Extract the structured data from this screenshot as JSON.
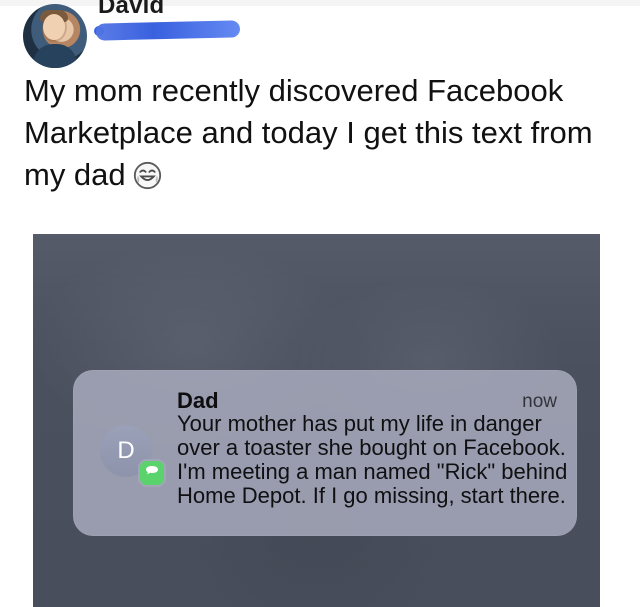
{
  "post": {
    "author_name": "David",
    "text": "My mom recently discovered Facebook Marketplace and today I get this text from my dad"
  },
  "icons": {
    "author_avatar": "profile-photo",
    "emoji": "face-with-tears-of-joy-icon",
    "contact_avatar": "contact-initial-avatar",
    "message_badge": "messages-app-icon"
  },
  "notification": {
    "sender": "Dad",
    "time": "now",
    "avatar_initial": "D",
    "message": "Your mother has put my life in danger over a toaster she bought on Facebook. I'm meeting a man named \"Rick\" behind Home Depot. If I go missing, start there."
  },
  "colors": {
    "redaction": "#3f67e7",
    "notification_bg": "#a4a7b9",
    "messages_green": "#5bd36d",
    "photo_bg": "#4f5562"
  }
}
